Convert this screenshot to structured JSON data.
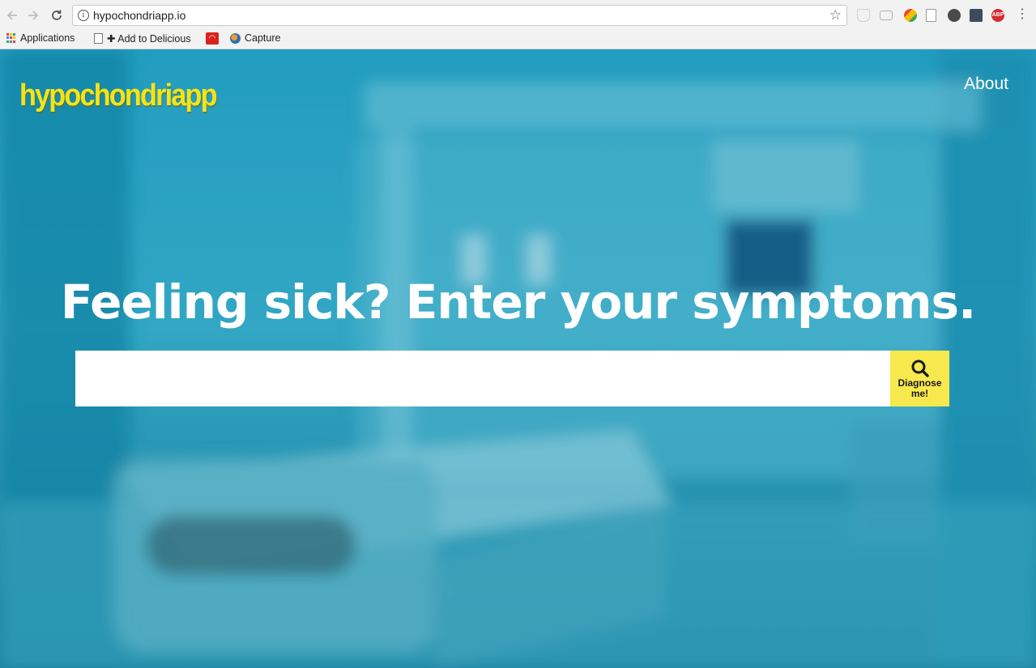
{
  "browser": {
    "url": "hypochondriapp.io",
    "bookmarks": [
      {
        "label": "Applications",
        "icon": "apps-grid-icon"
      },
      {
        "label": "✚ Add to Delicious",
        "icon": "page-icon"
      },
      {
        "label": "",
        "icon": "wifi-icon"
      },
      {
        "label": "Capture",
        "icon": "capture-icon"
      }
    ],
    "extensions": [
      "shield-extension-icon",
      "cast-icon",
      "google-extension-icon",
      "document-extension-icon",
      "circle-extension-icon",
      "password-extension-icon",
      "adblock-plus-icon",
      "menu-icon"
    ],
    "adblock_label": "ABP"
  },
  "site": {
    "logo": "hypochondriapp",
    "nav": {
      "about": "About"
    },
    "headline": "Feeling sick? Enter your symptoms.",
    "search": {
      "value": "",
      "placeholder": "",
      "button_label": "Diagnose me!"
    }
  },
  "colors": {
    "accent": "#f7e94d",
    "logo": "#f5e31a",
    "background": "#1a8fb3"
  }
}
